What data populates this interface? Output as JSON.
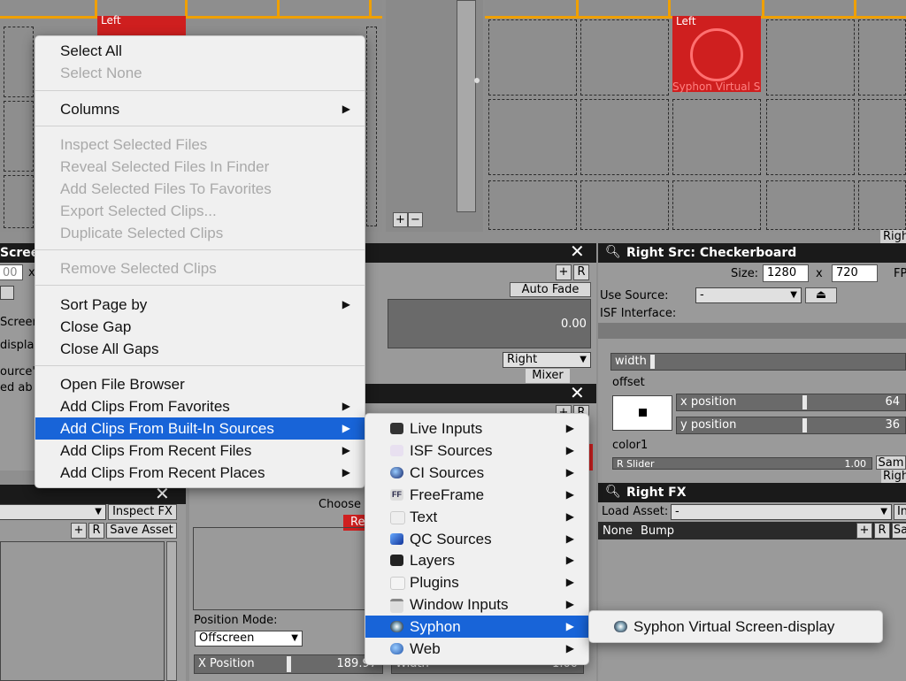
{
  "clip_left_label": "Left",
  "clip_right_label": "Left",
  "clip_right_name": "Syphon Virtual S",
  "grid_plus": "+",
  "grid_minus": "−",
  "right_top_tab": "Righ",
  "left_panel": {
    "title": "Screen",
    "field_x": "00",
    "x_label": "x",
    "screen_text": "Screen",
    "display_text": "displa",
    "source_text": "ource\"",
    "ab_text": "ed ab"
  },
  "mid_top_panel": {
    "plus": "+",
    "r": "R",
    "auto_fade": "Auto Fade",
    "value": "0.00",
    "combo_right": "Right",
    "mixer": "Mixer"
  },
  "mid_bottom_panel": {
    "plus": "+",
    "r": "R",
    "choose": "Choose",
    "re": "Re",
    "position_mode_label": "Position Mode:",
    "position_mode_value": "Offscreen",
    "x_position_label": "X Position",
    "x_position_value": "189.97",
    "width_label": "Width",
    "width_value": "1.00"
  },
  "left_bottom_panel": {
    "inspect_fx": "Inspect FX",
    "plus": "+",
    "r": "R",
    "save_asset": "Save Asset"
  },
  "right_src_panel": {
    "title": "Right Src: Checkerboard",
    "size_label": "Size:",
    "width_value": "1280",
    "x_label": "x",
    "height_value": "720",
    "fps_label": "FP",
    "use_source_label": "Use Source:",
    "use_source_value": "-",
    "isf_interface_label": "ISF Interface:",
    "width_slider": "width",
    "offset_label": "offset",
    "x_position_label": "x position",
    "x_position_value": "64",
    "y_position_label": "y position",
    "y_position_value": "36",
    "color1_label": "color1",
    "r_slider_label": "R Slider",
    "r_slider_value": "1.00",
    "sam_btn": "Sam",
    "right_tab": "Righ"
  },
  "right_fx_panel": {
    "title": "Right FX",
    "load_asset_label": "Load Asset:",
    "load_asset_value": "-",
    "in_btn": "In",
    "none_tab": "None",
    "bump_tab": "Bump",
    "plus": "+",
    "r": "R",
    "sa": "Sa"
  },
  "context_menu": {
    "items": [
      {
        "label": "Select All",
        "disabled": false,
        "submenu": false
      },
      {
        "label": "Select None",
        "disabled": true,
        "submenu": false
      },
      {
        "label": "Columns",
        "disabled": false,
        "submenu": true
      },
      {
        "label": "Inspect Selected Files",
        "disabled": true,
        "submenu": false
      },
      {
        "label": "Reveal Selected Files In Finder",
        "disabled": true,
        "submenu": false
      },
      {
        "label": "Add Selected Files To Favorites",
        "disabled": true,
        "submenu": false
      },
      {
        "label": "Export Selected Clips...",
        "disabled": true,
        "submenu": false
      },
      {
        "label": "Duplicate Selected Clips",
        "disabled": true,
        "submenu": false
      },
      {
        "label": "Remove Selected Clips",
        "disabled": true,
        "submenu": false
      },
      {
        "label": "Sort Page by",
        "disabled": false,
        "submenu": true
      },
      {
        "label": "Close Gap",
        "disabled": false,
        "submenu": false
      },
      {
        "label": "Close All Gaps",
        "disabled": false,
        "submenu": false
      },
      {
        "label": "Open File Browser",
        "disabled": false,
        "submenu": false
      },
      {
        "label": "Add Clips From Favorites",
        "disabled": false,
        "submenu": true
      },
      {
        "label": "Add Clips From Built-In Sources",
        "disabled": false,
        "submenu": true,
        "selected": true
      },
      {
        "label": "Add Clips From Recent Files",
        "disabled": false,
        "submenu": true
      },
      {
        "label": "Add Clips From Recent Places",
        "disabled": false,
        "submenu": true
      }
    ],
    "arrow": "▶"
  },
  "sources_submenu": {
    "items": [
      {
        "label": "Live Inputs",
        "icon": "camera-icon"
      },
      {
        "label": "ISF Sources",
        "icon": "isf-icon"
      },
      {
        "label": "CI Sources",
        "icon": "ci-icon"
      },
      {
        "label": "FreeFrame",
        "icon": "freeframe-icon"
      },
      {
        "label": "Text",
        "icon": "text-icon"
      },
      {
        "label": "QC Sources",
        "icon": "qc-icon"
      },
      {
        "label": "Layers",
        "icon": "layers-icon"
      },
      {
        "label": "Plugins",
        "icon": "plugins-icon"
      },
      {
        "label": "Window Inputs",
        "icon": "window-icon"
      },
      {
        "label": "Syphon",
        "icon": "syphon-icon",
        "selected": true
      },
      {
        "label": "Web",
        "icon": "web-icon"
      }
    ],
    "freeframe_glyph": "FF"
  },
  "syphon_submenu": {
    "item": "Syphon Virtual Screen-display"
  },
  "colors": {
    "menu_highlight": "#1864d8",
    "clip_red": "#cf1f1f",
    "grid_orange": "#f0a000"
  }
}
